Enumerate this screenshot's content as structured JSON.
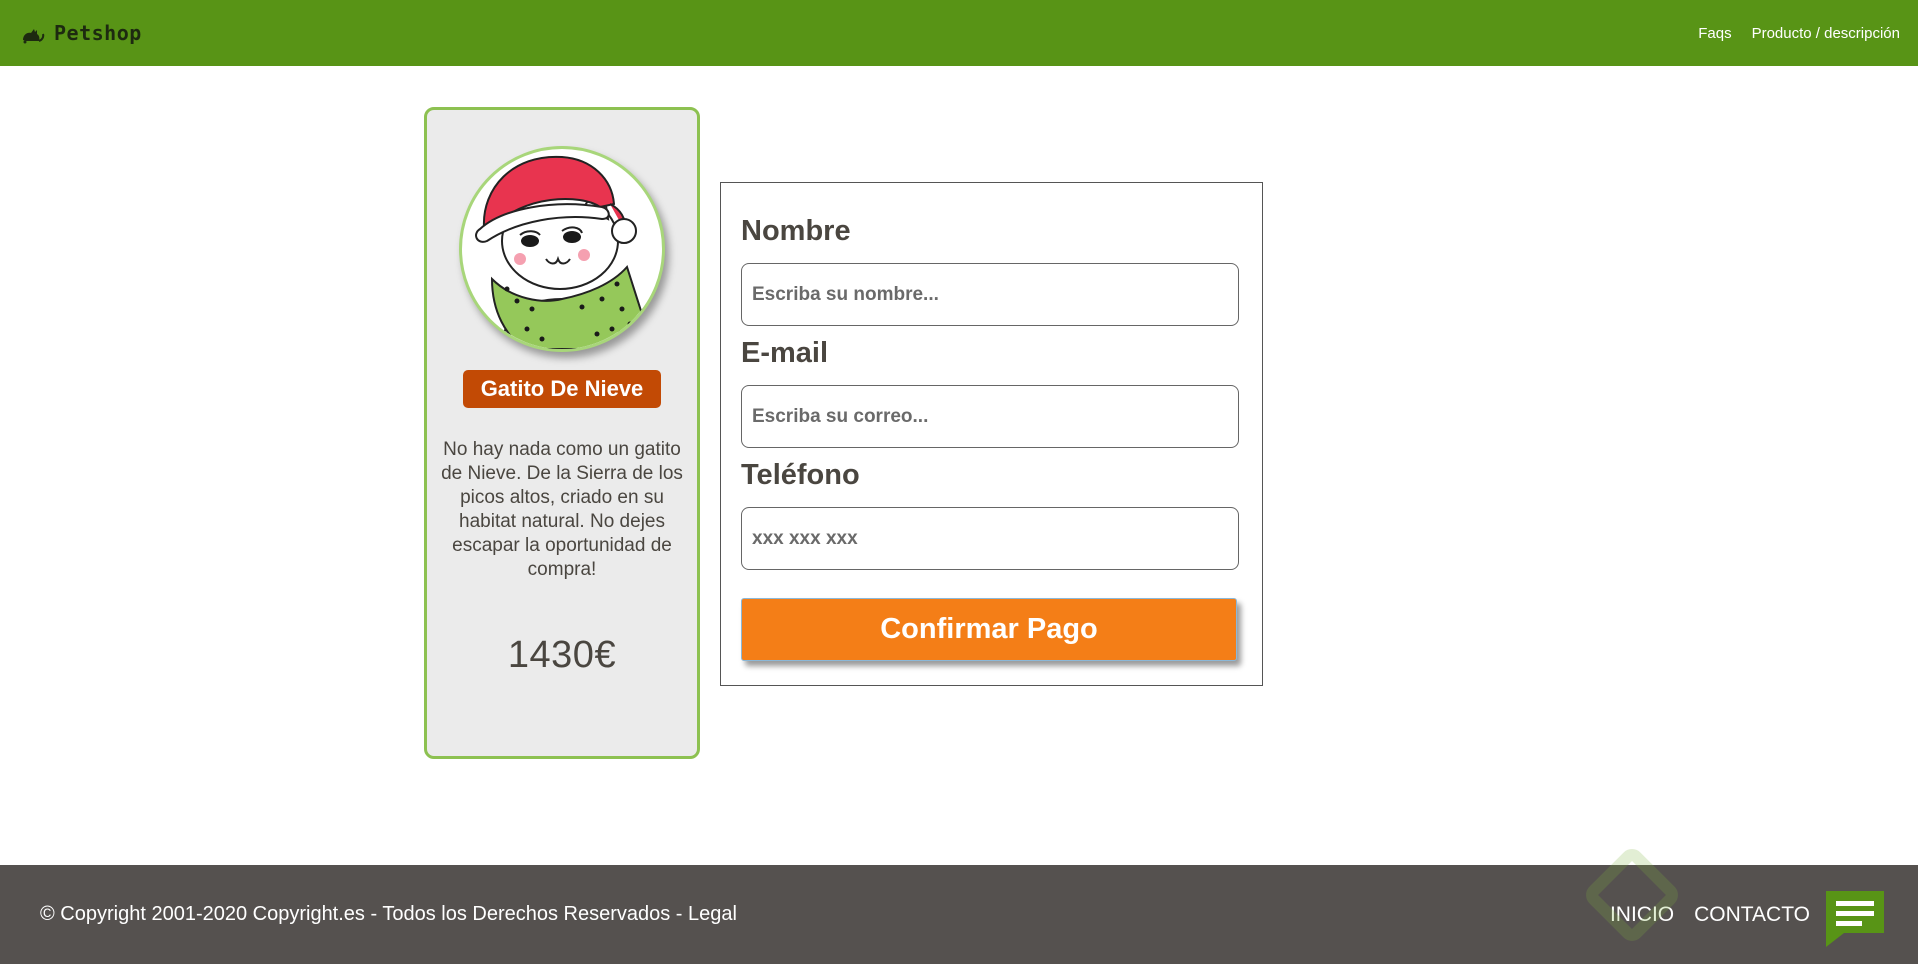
{
  "navbar": {
    "brand": "Petshop",
    "links": [
      "Faqs",
      "Producto / descripción"
    ]
  },
  "product": {
    "name": "Gatito De Nieve",
    "description": "No hay nada como un gatito de Nieve. De la Sierra de los picos altos, criado en su habitat natural. No dejes escapar la oportunidad de compra!",
    "price": "1430€"
  },
  "form": {
    "name_label": "Nombre",
    "name_placeholder": "Escriba su nombre...",
    "email_label": "E-mail",
    "email_placeholder": "Escriba su correo...",
    "phone_label": "Teléfono",
    "phone_placeholder": "xxx xxx xxx",
    "submit_label": "Confirmar Pago"
  },
  "footer": {
    "copyright": "© Copyright 2001-2020 Copyright.es - Todos los Derechos Reservados - Legal",
    "links": [
      "INICIO",
      "CONTACTO"
    ]
  },
  "icons": {
    "brand": "cat-icon",
    "chat": "chat-icon"
  },
  "colors": {
    "navbar": "#589416",
    "card_border": "#8dc151",
    "name_badge": "#c24a05",
    "submit_button": "#f47e17",
    "footer": "#55514f"
  }
}
